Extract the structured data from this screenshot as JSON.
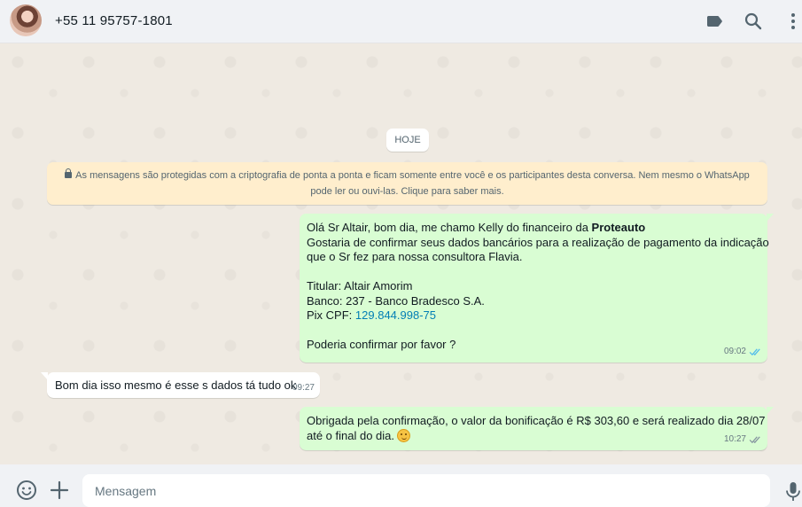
{
  "header": {
    "contact_name": "+55 11 95757-1801",
    "icons": [
      "label-icon",
      "search-icon",
      "menu-icon"
    ]
  },
  "chat": {
    "date_label": "HOJE",
    "encryption_notice": {
      "line1": "As mensagens são protegidas com a criptografia de ponta a ponta e ficam somente entre você e os participantes desta conversa. Nem mesmo o WhatsApp",
      "line2": "pode ler ou ouvi-las. Clique para saber mais."
    },
    "messages": [
      {
        "direction": "outgoing",
        "greeting_prefix": "Olá Sr Altair, bom dia, me chamo Kelly do financeiro da ",
        "greeting_bold": "Proteauto",
        "line2": "Gostaria de confirmar seus dados bancários para a realização de pagamento da indicação",
        "line3": "que o Sr fez para nossa consultora Flavia.",
        "titular": "Titular:  Altair Amorim",
        "banco": "Banco: 237 - Banco Bradesco S.A.",
        "pix_label": "Pix CPF: ",
        "pix_value": "129.844.998-75",
        "closing": "Poderia confirmar por favor ?",
        "time": "09:02",
        "status": "read"
      },
      {
        "direction": "incoming",
        "text": "Bom dia isso mesmo é esse s dados tá tudo ok",
        "time": "09:27"
      },
      {
        "direction": "outgoing",
        "line1": "Obrigada pela confirmação, o valor da bonificação é R$ 303,60 e será realizado dia 28/07",
        "line2": "até o final do dia.",
        "emoji": "slightly-smiling-face",
        "time": "10:27",
        "status": "delivered"
      }
    ]
  },
  "composer": {
    "placeholder": "Mensagem",
    "value": ""
  },
  "colors": {
    "outgoing_bubble": "#d9fdd3",
    "incoming_bubble": "#ffffff",
    "notice_bg": "#ffeecd",
    "read_ticks": "#53bdeb",
    "link": "#027eb5"
  }
}
